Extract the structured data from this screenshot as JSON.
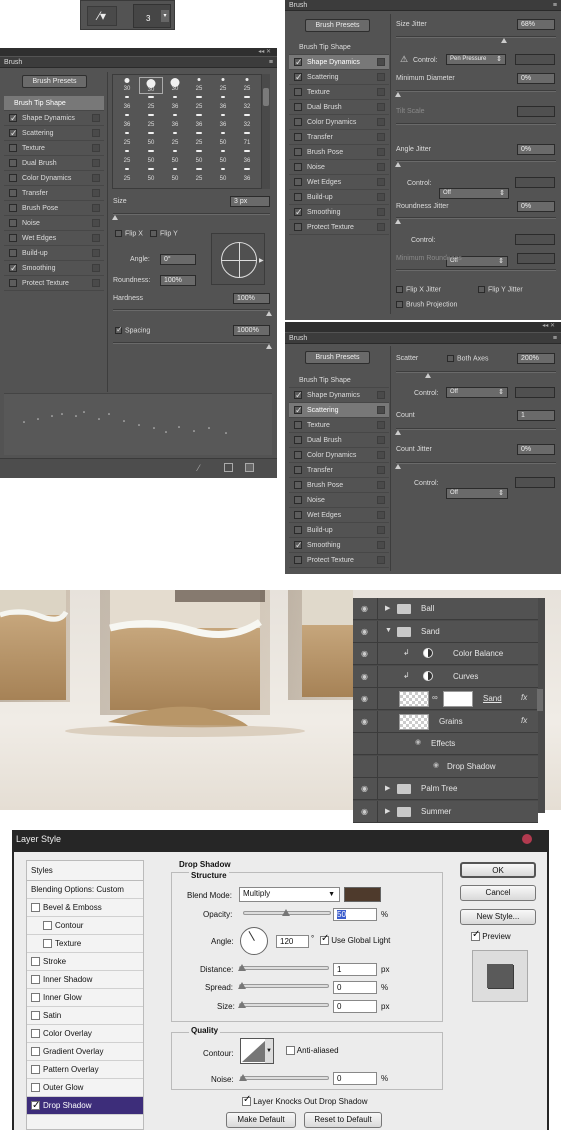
{
  "toolbar": {
    "brush_size": "3"
  },
  "panel_left": {
    "title": "Brush",
    "presets_btn": "Brush Presets",
    "items": [
      {
        "label": "Brush Tip Shape",
        "checked": false,
        "selected": true
      },
      {
        "label": "Shape Dynamics",
        "checked": true
      },
      {
        "label": "Scattering",
        "checked": true
      },
      {
        "label": "Texture",
        "checked": false
      },
      {
        "label": "Dual Brush",
        "checked": false
      },
      {
        "label": "Color Dynamics",
        "checked": false
      },
      {
        "label": "Transfer",
        "checked": false
      },
      {
        "label": "Brush Pose",
        "checked": false
      },
      {
        "label": "Noise",
        "checked": false
      },
      {
        "label": "Wet Edges",
        "checked": false
      },
      {
        "label": "Build-up",
        "checked": false
      },
      {
        "label": "Smoothing",
        "checked": true
      },
      {
        "label": "Protect Texture",
        "checked": false
      }
    ],
    "tip_rows": [
      [
        "30",
        "30",
        "30",
        "25",
        "25",
        "25"
      ],
      [
        "36",
        "25",
        "36",
        "25",
        "36",
        "32"
      ],
      [
        "36",
        "25",
        "36",
        "36",
        "36",
        "32"
      ],
      [
        "25",
        "50",
        "25",
        "25",
        "50",
        "71"
      ],
      [
        "25",
        "50",
        "50",
        "50",
        "50",
        "36"
      ],
      [
        "25",
        "50",
        "50",
        "25",
        "50",
        "36"
      ]
    ],
    "size_label": "Size",
    "size_value": "3 px",
    "flip_x": "Flip X",
    "flip_y": "Flip Y",
    "angle_label": "Angle:",
    "angle_value": "0°",
    "roundness_label": "Roundness:",
    "roundness_value": "100%",
    "hardness_label": "Hardness",
    "hardness_value": "100%",
    "spacing_label": "Spacing",
    "spacing_value": "1000%"
  },
  "panel_top_right": {
    "title": "Brush",
    "presets_btn": "Brush Presets",
    "items": [
      {
        "label": "Brush Tip Shape",
        "checked": false
      },
      {
        "label": "Shape Dynamics",
        "checked": true,
        "selected": true
      },
      {
        "label": "Scattering",
        "checked": true
      },
      {
        "label": "Texture",
        "checked": false
      },
      {
        "label": "Dual Brush",
        "checked": false
      },
      {
        "label": "Color Dynamics",
        "checked": false
      },
      {
        "label": "Transfer",
        "checked": false
      },
      {
        "label": "Brush Pose",
        "checked": false
      },
      {
        "label": "Noise",
        "checked": false
      },
      {
        "label": "Wet Edges",
        "checked": false
      },
      {
        "label": "Build-up",
        "checked": false
      },
      {
        "label": "Smoothing",
        "checked": true
      },
      {
        "label": "Protect Texture",
        "checked": false
      }
    ],
    "size_jitter_label": "Size Jitter",
    "size_jitter_value": "68%",
    "control_label": "Control:",
    "control1_value": "Pen Pressure",
    "min_diameter_label": "Minimum Diameter",
    "min_diameter_value": "0%",
    "tilt_scale_label": "Tilt Scale",
    "angle_jitter_label": "Angle Jitter",
    "angle_jitter_value": "0%",
    "control2_value": "Off",
    "roundness_jitter_label": "Roundness Jitter",
    "roundness_jitter_value": "0%",
    "control3_value": "Off",
    "min_roundness_label": "Minimum Roundness",
    "flip_x_jitter": "Flip X Jitter",
    "flip_y_jitter": "Flip Y Jitter",
    "brush_projection": "Brush Projection"
  },
  "panel_bottom_right": {
    "title": "Brush",
    "presets_btn": "Brush Presets",
    "items": [
      {
        "label": "Brush Tip Shape",
        "checked": false
      },
      {
        "label": "Shape Dynamics",
        "checked": true
      },
      {
        "label": "Scattering",
        "checked": true,
        "selected": true
      },
      {
        "label": "Texture",
        "checked": false
      },
      {
        "label": "Dual Brush",
        "checked": false
      },
      {
        "label": "Color Dynamics",
        "checked": false
      },
      {
        "label": "Transfer",
        "checked": false
      },
      {
        "label": "Brush Pose",
        "checked": false
      },
      {
        "label": "Noise",
        "checked": false
      },
      {
        "label": "Wet Edges",
        "checked": false
      },
      {
        "label": "Build-up",
        "checked": false
      },
      {
        "label": "Smoothing",
        "checked": true
      },
      {
        "label": "Protect Texture",
        "checked": false
      }
    ],
    "scatter_label": "Scatter",
    "both_axes": "Both Axes",
    "scatter_value": "200%",
    "control_label": "Control:",
    "control1_value": "Off",
    "count_label": "Count",
    "count_value": "1",
    "count_jitter_label": "Count Jitter",
    "count_jitter_value": "0%",
    "control2_value": "Off"
  },
  "layers": [
    {
      "name": "Ball",
      "type": "group",
      "indent": 0
    },
    {
      "name": "Sand",
      "type": "group-open",
      "indent": 0
    },
    {
      "name": "Color Balance",
      "type": "adjustment",
      "indent": 1
    },
    {
      "name": "Curves",
      "type": "adjustment",
      "indent": 1
    },
    {
      "name": "Sand",
      "type": "masked",
      "indent": 1
    },
    {
      "name": "Grains",
      "type": "layer",
      "indent": 1
    },
    {
      "name": "Effects",
      "type": "effects",
      "indent": 2
    },
    {
      "name": "Drop Shadow",
      "type": "effect",
      "indent": 3
    },
    {
      "name": "Palm Tree",
      "type": "group",
      "indent": 0
    },
    {
      "name": "Summer",
      "type": "group",
      "indent": 0
    }
  ],
  "fx_label": "fx",
  "layer_style": {
    "title": "Layer Style",
    "styles_header": "Styles",
    "blending": "Blending Options: Custom",
    "items": [
      {
        "label": "Bevel & Emboss",
        "checked": false,
        "indent": false
      },
      {
        "label": "Contour",
        "checked": false,
        "indent": true
      },
      {
        "label": "Texture",
        "checked": false,
        "indent": true
      },
      {
        "label": "Stroke",
        "checked": false,
        "indent": false
      },
      {
        "label": "Inner Shadow",
        "checked": false,
        "indent": false
      },
      {
        "label": "Inner Glow",
        "checked": false,
        "indent": false
      },
      {
        "label": "Satin",
        "checked": false,
        "indent": false
      },
      {
        "label": "Color Overlay",
        "checked": false,
        "indent": false
      },
      {
        "label": "Gradient Overlay",
        "checked": false,
        "indent": false
      },
      {
        "label": "Pattern Overlay",
        "checked": false,
        "indent": false
      },
      {
        "label": "Outer Glow",
        "checked": false,
        "indent": false
      },
      {
        "label": "Drop Shadow",
        "checked": true,
        "indent": false,
        "selected": true
      }
    ],
    "section": "Drop Shadow",
    "structure": "Structure",
    "blend_mode_label": "Blend Mode:",
    "blend_mode_value": "Multiply",
    "shadow_color": "#4e3a2c",
    "opacity_label": "Opacity:",
    "opacity_value": "50",
    "percent": "%",
    "angle_label": "Angle:",
    "angle_value": "120",
    "degree": "°",
    "use_global_light": "Use Global Light",
    "distance_label": "Distance:",
    "distance_value": "1",
    "spread_label": "Spread:",
    "spread_value": "0",
    "size_label": "Size:",
    "size_value": "0",
    "px": "px",
    "quality": "Quality",
    "contour_label": "Contour:",
    "anti_aliased": "Anti-aliased",
    "noise_label": "Noise:",
    "noise_value": "0",
    "knockout": "Layer Knocks Out Drop Shadow",
    "make_default": "Make Default",
    "reset_default": "Reset to Default",
    "ok": "OK",
    "cancel": "Cancel",
    "new_style": "New Style...",
    "preview": "Preview"
  }
}
